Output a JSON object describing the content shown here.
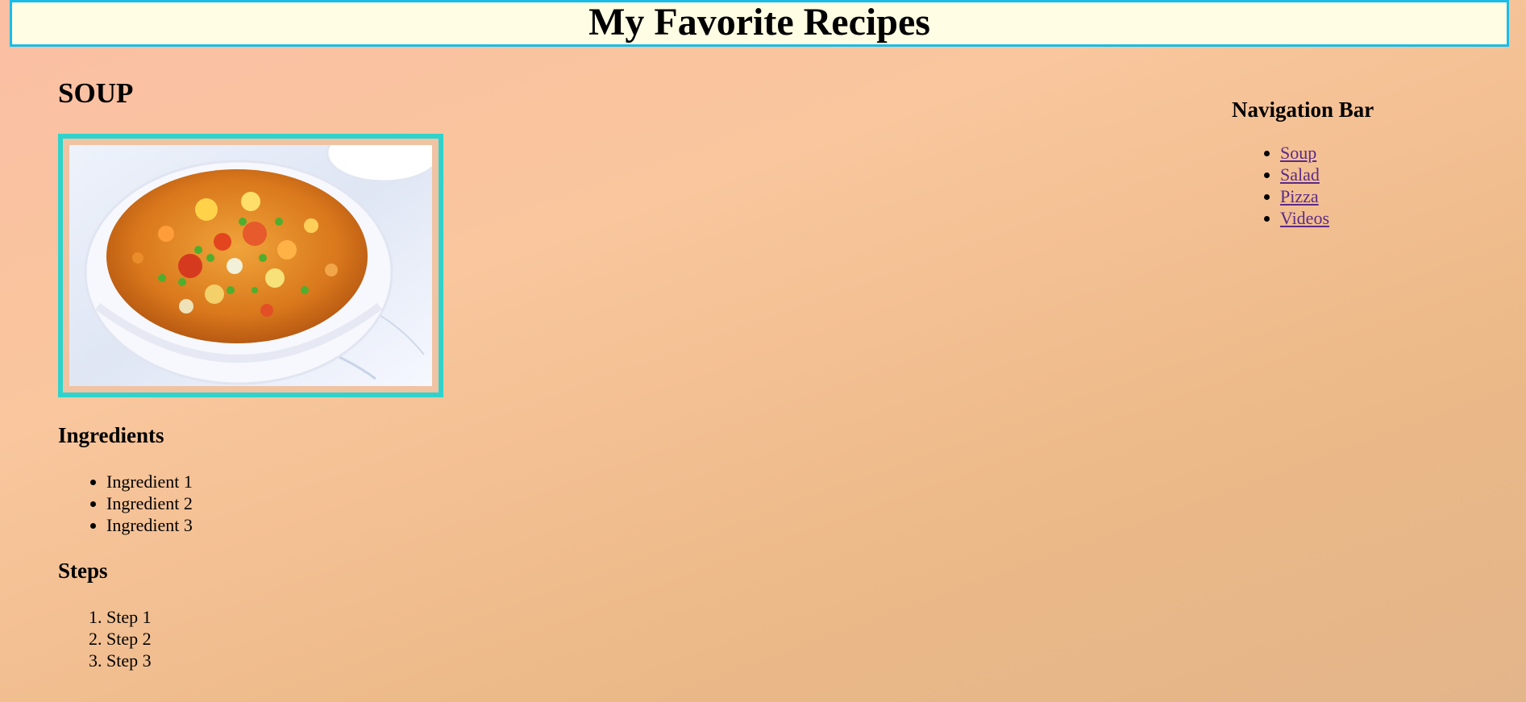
{
  "header": {
    "title": "My Favorite Recipes"
  },
  "main": {
    "section_title": "SOUP",
    "image_alt": "Vegetable soup in a white bowl",
    "ingredients": {
      "title": "Ingredients",
      "items": [
        "Ingredient 1",
        "Ingredient 2",
        "Ingredient 3"
      ]
    },
    "steps": {
      "title": "Steps",
      "items": [
        "Step 1",
        "Step 2",
        "Step 3"
      ]
    }
  },
  "nav": {
    "title": "Navigation Bar",
    "links": [
      "Soup",
      "Salad",
      "Pizza",
      "Videos"
    ]
  },
  "colors": {
    "header_bg": "#fffde3",
    "header_border": "#19bde7",
    "image_border": "#2fd3cb",
    "link": "#5b2a86"
  }
}
